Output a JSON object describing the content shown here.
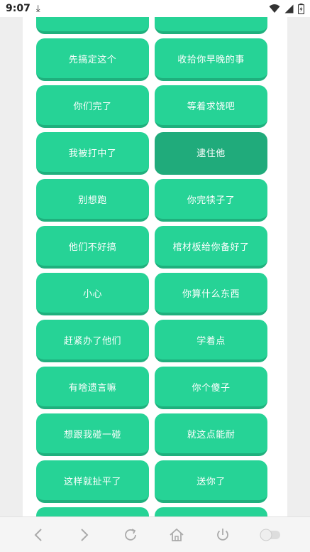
{
  "status": {
    "time": "9:07",
    "download_glyph": "⤓"
  },
  "buttons": [
    {
      "label": ""
    },
    {
      "label": ""
    },
    {
      "label": "先搞定这个"
    },
    {
      "label": "收拾你早晚的事"
    },
    {
      "label": "你们完了"
    },
    {
      "label": "等着求饶吧"
    },
    {
      "label": "我被打中了"
    },
    {
      "label": "逮住他",
      "active": true
    },
    {
      "label": "别想跑"
    },
    {
      "label": "你完犊子了"
    },
    {
      "label": "他们不好搞"
    },
    {
      "label": "棺材板给你备好了"
    },
    {
      "label": "小心"
    },
    {
      "label": "你算什么东西"
    },
    {
      "label": "赶紧办了他们"
    },
    {
      "label": "学着点"
    },
    {
      "label": "有啥遗言嘛"
    },
    {
      "label": "你个傻子"
    },
    {
      "label": "想跟我碰一碰"
    },
    {
      "label": "就这点能耐"
    },
    {
      "label": "这样就扯平了"
    },
    {
      "label": "送你了"
    },
    {
      "label": ""
    },
    {
      "label": ""
    }
  ],
  "colors": {
    "button": "#26d396",
    "button_shadow": "#1fb07d",
    "button_active": "#20ab7b"
  },
  "nav": {
    "icons": [
      "back-icon",
      "forward-icon",
      "refresh-icon",
      "home-icon",
      "power-icon",
      "toggle-icon"
    ]
  }
}
